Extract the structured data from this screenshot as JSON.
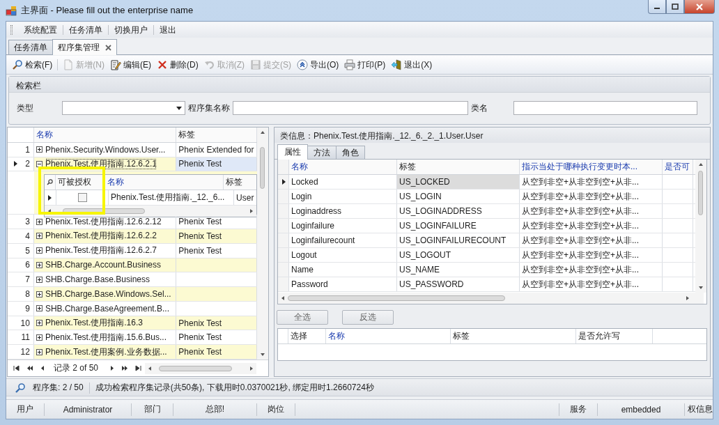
{
  "window": {
    "title": "主界面 - Please fill out the enterprise name"
  },
  "menu": [
    "系统配置",
    "任务清单",
    "切换用户",
    "退出"
  ],
  "doc_tabs": [
    {
      "label": "任务清单",
      "selected": false,
      "closable": false
    },
    {
      "label": "程序集管理",
      "selected": true,
      "closable": true
    }
  ],
  "toolbar": [
    {
      "label": "检索(F)",
      "disabled": false
    },
    {
      "label": "新增(N)",
      "disabled": true
    },
    {
      "label": "编辑(E)",
      "disabled": false
    },
    {
      "label": "删除(D)",
      "disabled": false
    },
    {
      "label": "取消(Z)",
      "disabled": true
    },
    {
      "label": "提交(S)",
      "disabled": true
    },
    {
      "label": "导出(O)",
      "disabled": false
    },
    {
      "label": "打印(P)",
      "disabled": false
    },
    {
      "label": "退出(X)",
      "disabled": false
    }
  ],
  "search_panel": {
    "title": "检索栏",
    "fields": [
      {
        "label": "类型",
        "kind": "combo"
      },
      {
        "label": "程序集名称",
        "kind": "text"
      },
      {
        "label": "类名",
        "kind": "text"
      }
    ]
  },
  "assembly_grid": {
    "columns": [
      {
        "label": "名称",
        "accent": true
      },
      {
        "label": "标签",
        "accent": false
      }
    ],
    "rows": [
      {
        "number": "1",
        "name": "Phenix.Security.Windows.User...",
        "tag": "Phenix Extended for",
        "selected": false,
        "expanded": false
      },
      {
        "number": "2",
        "name": "Phenix.Test.使用指南.12.6.2.1",
        "tag": "Phenix Test",
        "selected": true,
        "expanded": true,
        "detail": {
          "columns": [
            {
              "label": "可被授权",
              "accent": false
            },
            {
              "label": "名称",
              "accent": true
            },
            {
              "label": "标签",
              "accent": false
            }
          ],
          "rows": [
            {
              "checked": false,
              "name": "Phenix.Test.使用指南._12._6...",
              "tag": "User",
              "selected": true
            }
          ]
        }
      },
      {
        "number": "3",
        "name": "Phenix.Test.使用指南.12.6.2.12",
        "tag": "Phenix Test",
        "selected": false,
        "expanded": false
      },
      {
        "number": "4",
        "name": "Phenix.Test.使用指南.12.6.2.2",
        "tag": "Phenix Test",
        "selected": false,
        "expanded": false
      },
      {
        "number": "5",
        "name": "Phenix.Test.使用指南.12.6.2.7",
        "tag": "Phenix Test",
        "selected": false,
        "expanded": false
      },
      {
        "number": "6",
        "name": "SHB.Charge.Account.Business",
        "selected": false,
        "expanded": false
      },
      {
        "number": "7",
        "name": "SHB.Charge.Base.Business",
        "selected": false,
        "expanded": false
      },
      {
        "number": "8",
        "name": "SHB.Charge.Base.Windows.Sel...",
        "selected": false,
        "expanded": false
      },
      {
        "number": "9",
        "name": "SHB.Charge.BaseAgreement.B...",
        "selected": false,
        "expanded": false
      },
      {
        "number": "10",
        "name": "Phenix.Test.使用指南.16.3",
        "tag": "Phenix Test",
        "selected": false,
        "expanded": false
      },
      {
        "number": "11",
        "name": "Phenix.Test.使用指南.15.6.Bus...",
        "tag": "Phenix Test",
        "selected": false,
        "expanded": false
      },
      {
        "number": "12",
        "name": "Phenix.Test.使用案例.业务数据...",
        "tag": "Phenix Test",
        "selected": false,
        "expanded": false
      }
    ],
    "navigator": {
      "record": "记录 2 of 50"
    }
  },
  "annotations": [
    {
      "kind": "highlight-box"
    }
  ],
  "class_info": "类信息：Phenix.Test.使用指南._12._6._2._1.User.User",
  "detail_tabs": [
    {
      "label": "属性",
      "selected": true
    },
    {
      "label": "方法",
      "selected": false
    },
    {
      "label": "角色",
      "selected": false
    }
  ],
  "property_grid": {
    "columns": [
      {
        "label": "名称",
        "accent": true
      },
      {
        "label": "标签",
        "accent": false
      },
      {
        "label": "指示当处于哪种执行变更时本...",
        "accent": true
      },
      {
        "label": "是否可",
        "accent": true
      }
    ],
    "rows": [
      {
        "name": "Locked",
        "tag": "US_LOCKED",
        "column_3": "从空到非空+从非空到空+从非...",
        "selected": true
      },
      {
        "name": "Login",
        "tag": "US_LOGIN",
        "column_3": "从空到非空+从非空到空+从非...",
        "selected": false
      },
      {
        "name": "Loginaddress",
        "tag": "US_LOGINADDRESS",
        "column_3": "从空到非空+从非空到空+从非...",
        "selected": false
      },
      {
        "name": "Loginfailure",
        "tag": "US_LOGINFAILURE",
        "column_3": "从空到非空+从非空到空+从非...",
        "selected": false
      },
      {
        "name": "Loginfailurecount",
        "tag": "US_LOGINFAILURECOUNT",
        "column_3": "从空到非空+从非空到空+从非...",
        "selected": false
      },
      {
        "name": "Logout",
        "tag": "US_LOGOUT",
        "column_3": "从空到非空+从非空到空+从非...",
        "selected": false
      },
      {
        "name": "Name",
        "tag": "US_NAME",
        "column_3": "从空到非空+从非空到空+从非...",
        "selected": false
      },
      {
        "name": "Password",
        "tag": "US_PASSWORD",
        "column_3": "从空到非空+从非空到空+从非...",
        "selected": false
      }
    ]
  },
  "selection_buttons": [
    "全选",
    "反选"
  ],
  "selection_grid": {
    "columns": [
      {
        "label": "选择",
        "accent": false
      },
      {
        "label": "名称",
        "accent": true
      },
      {
        "label": "标签",
        "accent": false
      },
      {
        "label": "是否允许写",
        "accent": false
      }
    ]
  },
  "status_bar": {
    "count": "程序集: 2 / 50",
    "message": "成功检索程序集记录(共50条), 下载用时0.0370021秒, 绑定用时1.2660724秒"
  },
  "user_bar": {
    "left": [
      "用户",
      "Administrator",
      "部门",
      "总部!",
      "岗位"
    ],
    "right": [
      "服务",
      "embedded",
      "权信息"
    ]
  }
}
